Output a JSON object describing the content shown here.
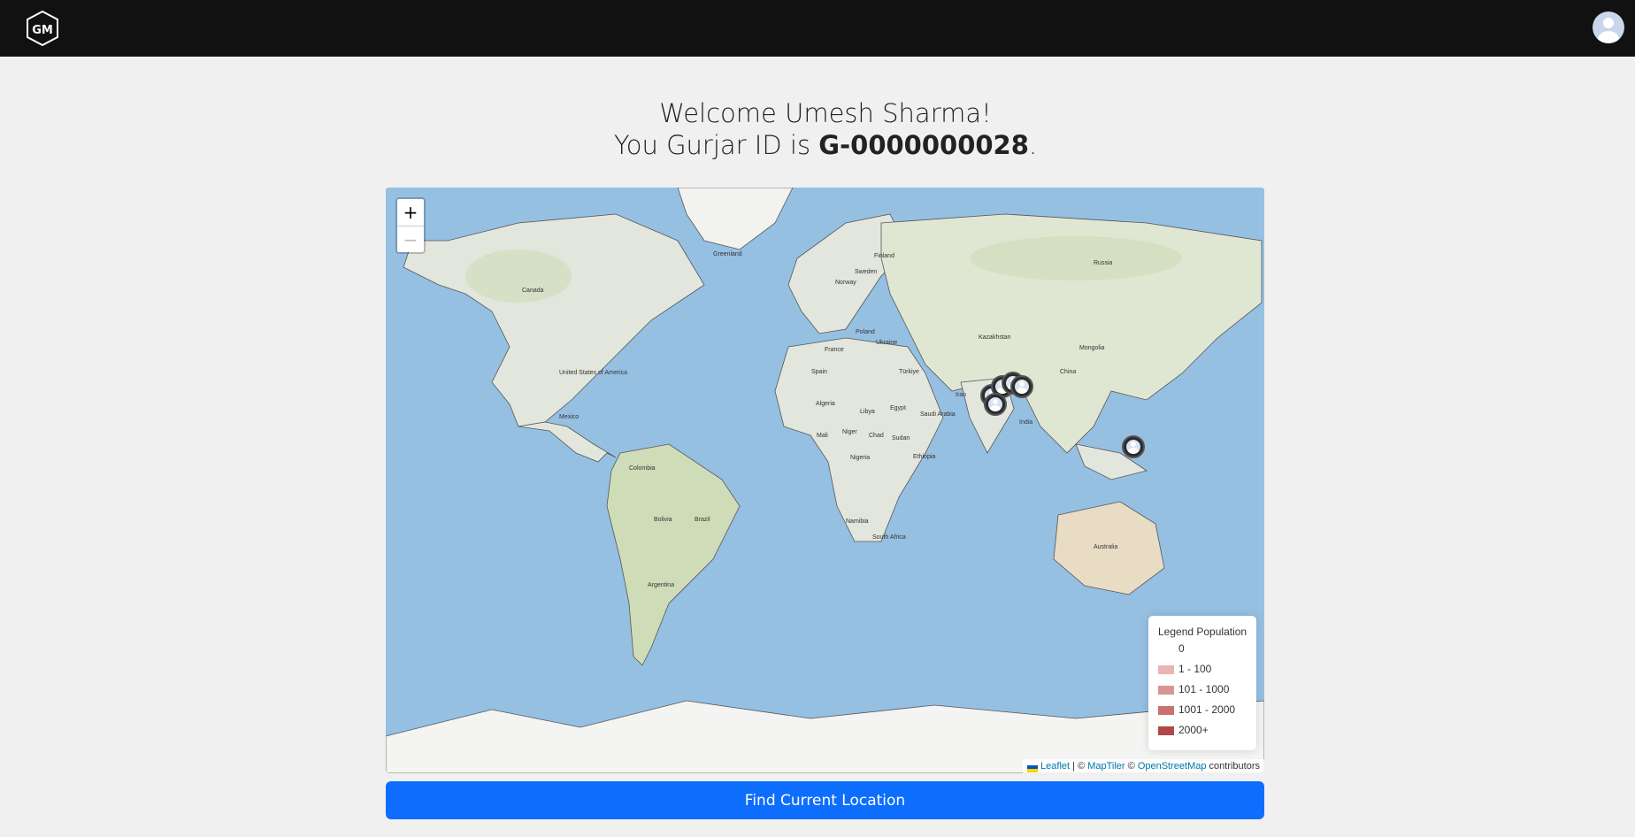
{
  "navbar": {
    "logo_icon": "gm-logo-icon",
    "avatar_icon": "user-avatar-icon"
  },
  "welcome": {
    "line1": "Welcome Umesh Sharma!",
    "line2_prefix": "You Gurjar ID is ",
    "gurjar_id": "G-0000000028",
    "line2_suffix": "."
  },
  "map": {
    "zoom_in": "+",
    "zoom_out": "−",
    "labels": [
      "Canada",
      "United States of America",
      "Mexico",
      "Colombia",
      "Brazil",
      "Bolivia",
      "Argentina",
      "Russia",
      "Kazakhstan",
      "Mongolia",
      "China",
      "Iran",
      "India",
      "Saudi Arabia",
      "Egypt",
      "Algeria",
      "Libya",
      "Niger",
      "Chad",
      "Sudan",
      "Ethiopia",
      "Nigeria",
      "Mali",
      "Australia",
      "Greenland",
      "Türkiye",
      "Spain",
      "France",
      "Poland",
      "Ukraine",
      "Norway",
      "Sweden",
      "Finland",
      "South Africa",
      "Namibia"
    ],
    "legend": {
      "title": "Legend Population",
      "items": [
        {
          "label": "0",
          "color": "#ffffff"
        },
        {
          "label": "1 - 100",
          "color": "#e8b4b4"
        },
        {
          "label": "101 - 1000",
          "color": "#d99494"
        },
        {
          "label": "1001 - 2000",
          "color": "#c97070"
        },
        {
          "label": "2000+",
          "color": "#b04848"
        }
      ]
    },
    "attribution": {
      "leaflet": "Leaflet",
      "sep1": " | © ",
      "maptiler": "MapTiler",
      "sep2": " © ",
      "osm": "OpenStreetMap",
      "suffix": " contributors"
    },
    "marker_icon": "user-location-marker-icon"
  },
  "button": {
    "find_location": "Find Current Location"
  },
  "colors": {
    "navbar": "#111111",
    "water": "#96c0e2",
    "land": "#e2e6dc",
    "accent": "#0d6efd"
  }
}
